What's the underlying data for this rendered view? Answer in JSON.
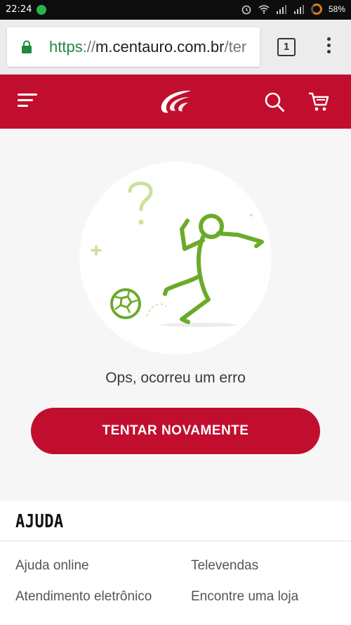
{
  "status_bar": {
    "time": "22:24",
    "battery": "58%"
  },
  "browser": {
    "url_scheme": "https",
    "url_separator": "://",
    "url_host": "m.centauro.com.br",
    "url_path": "/ter",
    "tab_count": "1"
  },
  "header": {
    "icons": [
      "menu-icon",
      "centauro-logo",
      "search-icon",
      "cart-icon"
    ]
  },
  "error": {
    "message": "Ops, ocorreu um erro",
    "button_label": "TENTAR NOVAMENTE"
  },
  "help": {
    "title": "AJUDA",
    "links": [
      "Ajuda online",
      "Televendas",
      "Atendimento eletrônico",
      "Encontre uma loja"
    ]
  },
  "colors": {
    "brand_red": "#c10e2f",
    "illustration_green": "#6aab2a",
    "secure_green": "#1f8a3d"
  }
}
